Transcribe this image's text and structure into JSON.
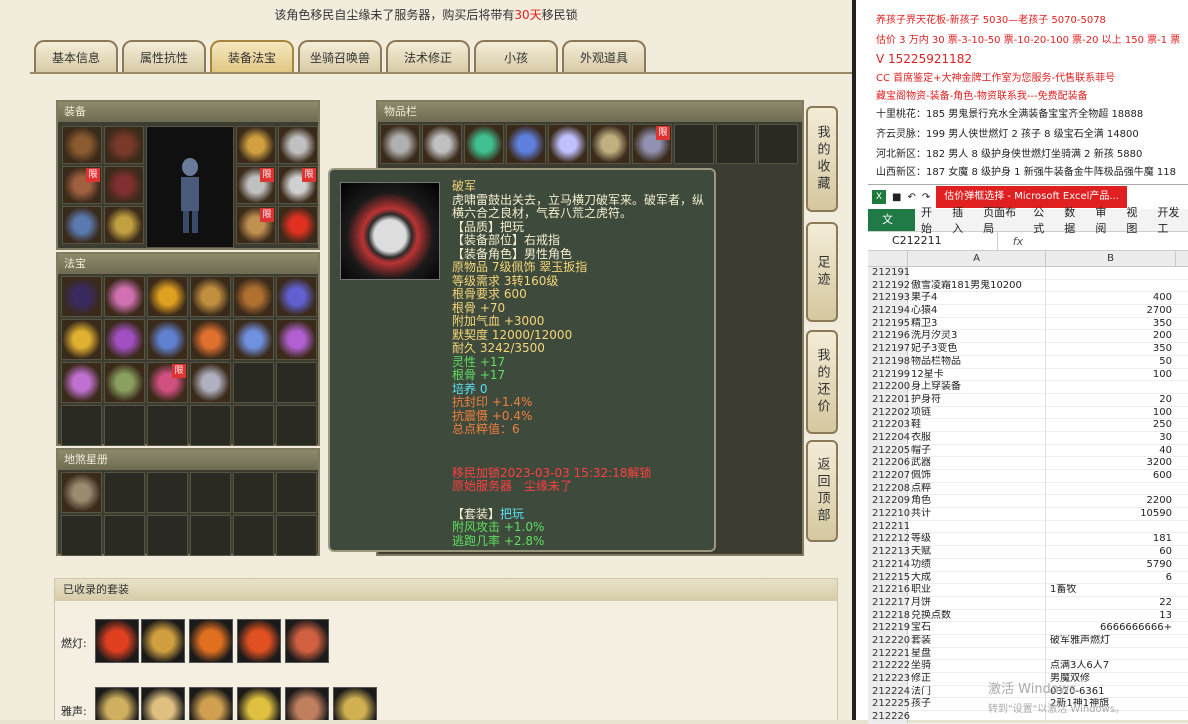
{
  "notice": {
    "prefix": "该角色移民自尘缘未了服务器，购买后将带有",
    "days": "30天",
    "suffix": "移民锁"
  },
  "tabs": [
    "基本信息",
    "属性抗性",
    "装备法宝",
    "坐骑召唤兽",
    "法术修正",
    "小孩",
    "外观道具"
  ],
  "active_tab": "装备法宝",
  "panels": {
    "equip": "装备",
    "fabao": "法宝",
    "dishayxingpan": "地煞星册",
    "inventory": "物品栏",
    "collection": "已收录的套装"
  },
  "limit_badge": "限",
  "side_buttons": [
    "我的收藏",
    "足迹",
    "我的还价",
    "返回顶部"
  ],
  "tooltip": {
    "name": "破军",
    "desc": "虎啸雷鼓出关去，立马横刀破军来。破军者，纵横六合之良材，气吞八荒之虎符。",
    "quality": "【品质】把玩",
    "slot": "【装备部位】右戒指",
    "role": "【装备角色】男性角色",
    "material": "原物品 7级佩饰 翠玉扳指",
    "level": "等级需求 3转160级",
    "gengu_req": "根骨要求 600",
    "gengu": "根骨 +70",
    "qixue": "附加气血 +3000",
    "moqi": "默契度 12000/12000",
    "naijiu": "耐久 3242/3500",
    "lingxing": "灵性 +17",
    "gengu2": "根骨 +17",
    "peiyang": "培养 0",
    "kangfengyin": "抗封印 +1.4%",
    "kangzhenshe": "抗震慑 +0.4%",
    "zongdian": "总点粹值：6",
    "migrate_line": "移民加锁2023-03-03 15:32:18解锁",
    "origin_line": "原始服务器　尘缘未了",
    "set_label": "【套装】",
    "set_name": "把玩",
    "set_a": "附风攻击 +1.0%",
    "set_b": "逃跑几率 +2.8%"
  },
  "collection_rows": [
    "燃灯:",
    "雅声:"
  ],
  "ads": {
    "l1": "养孩子界天花板-新孩子 5030—老孩子 5070-5078",
    "l2": "估价 3 万内 30 票-3-10-50 票-10-20-100 票-20 以上 150 票-1 票",
    "l3": "V 15225921182",
    "l4": "CC 首席鉴定+大神金牌工作室为您服务-代售联系菲号",
    "l5": "藏宝阁物资-装备-角色-物资联系我---免费配装备",
    "l6": "十里桃花：185 男鬼景行充水全满装备宝宝齐全物超 18888",
    "l7": "齐云灵脉：199 男人侠世燃灯 2 孩子 8 级宝石全满 14800",
    "l8": "河北新区：182 男人 8 级护身侠世燃灯坐骑满 2 新孩 5880",
    "l9": "山西新区：187 女魔 8 级护身 1 新强牛装备金牛阵极品强牛魔 118"
  },
  "excel": {
    "title": "估价弹框选择 - Microsoft Excel产品...",
    "ribbon": [
      "文件",
      "开始",
      "插入",
      "页面布局",
      "公式",
      "数据",
      "审阅",
      "视图",
      "开发工"
    ],
    "namebox": "C212211",
    "fx": "fx",
    "cols": [
      "A",
      "B"
    ],
    "rows": [
      [
        "212191",
        "",
        ""
      ],
      [
        "212192",
        "傲雪凌霜181男鬼10200",
        ""
      ],
      [
        "212193",
        "果子4",
        "400"
      ],
      [
        "212194",
        "心猿4",
        "2700"
      ],
      [
        "212195",
        "精卫3",
        "350"
      ],
      [
        "212196",
        "洗月汐灵3",
        "200"
      ],
      [
        "212197",
        "妃子3变色",
        "350"
      ],
      [
        "212198",
        "物品栏物品",
        "50"
      ],
      [
        "212199",
        "12星卡",
        "100"
      ],
      [
        "212200",
        "身上穿装备",
        ""
      ],
      [
        "212201",
        "护身符",
        "20"
      ],
      [
        "212202",
        "项链",
        "100"
      ],
      [
        "212203",
        "鞋",
        "250"
      ],
      [
        "212204",
        "衣服",
        "30"
      ],
      [
        "212205",
        "帽子",
        "40"
      ],
      [
        "212206",
        "武器",
        "3200"
      ],
      [
        "212207",
        "佩饰",
        "600"
      ],
      [
        "212208",
        "点粹",
        ""
      ],
      [
        "212209",
        "角色",
        "2200"
      ],
      [
        "212210",
        "共计",
        "10590"
      ],
      [
        "212211",
        "",
        ""
      ],
      [
        "212212",
        "等级",
        "181"
      ],
      [
        "212213",
        "天赋",
        "60"
      ],
      [
        "212214",
        "功绩",
        "5790"
      ],
      [
        "212215",
        "大成",
        "6"
      ],
      [
        "212216",
        "职业",
        "1畜牧"
      ],
      [
        "212217",
        "月饼",
        "22"
      ],
      [
        "212218",
        "兑换点数",
        "13"
      ],
      [
        "212219",
        "宝石",
        "6666666666+"
      ],
      [
        "212220",
        "套装",
        "破军雅声燃灯"
      ],
      [
        "212221",
        "星盘",
        ""
      ],
      [
        "212222",
        "坐骑",
        "点满3人6人7"
      ],
      [
        "212223",
        "修正",
        "男魔双修"
      ],
      [
        "212224",
        "法门",
        "0320-6361"
      ],
      [
        "212225",
        "孩子",
        "2新1神1神旗"
      ],
      [
        "212226",
        "",
        ""
      ]
    ],
    "left_text_cols": [
      "212216",
      "212220",
      "212222",
      "212223",
      "212224",
      "212225"
    ]
  },
  "watermark": {
    "line1": "激活 Windows",
    "line2": "转到\"设置\"以激活 Windows。"
  },
  "colors": {
    "accent": "#e02020",
    "tooltip_bg": "#3e4a3c",
    "panel": "#3c3c30"
  }
}
